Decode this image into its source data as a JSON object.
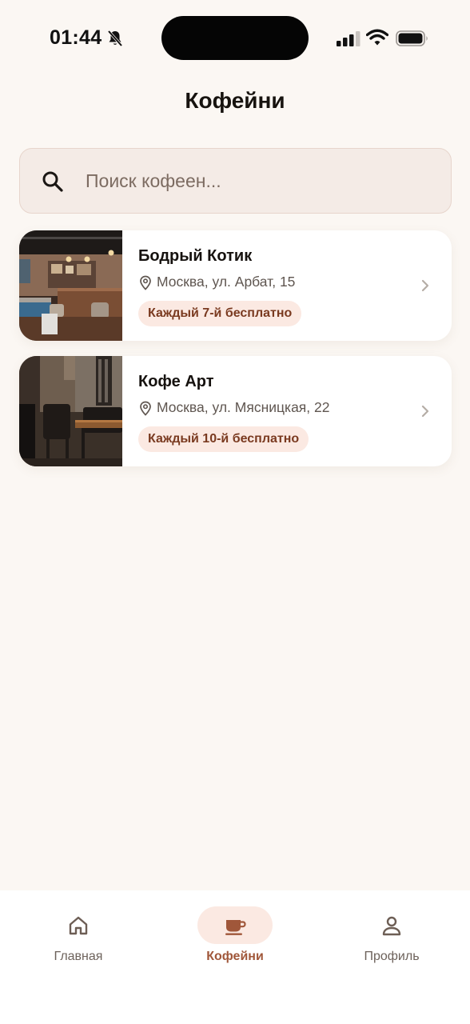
{
  "status_bar": {
    "time": "01:44"
  },
  "header": {
    "title": "Кофейни"
  },
  "search": {
    "placeholder": "Поиск кофеен..."
  },
  "cafes": [
    {
      "name": "Бодрый Котик",
      "address": "Москва, ул. Арбат, 15",
      "promo": "Каждый 7-й бесплатно"
    },
    {
      "name": "Кофе Арт",
      "address": "Москва, ул. Мясницкая, 22",
      "promo": "Каждый 10-й бесплатно"
    }
  ],
  "tab_bar": {
    "tabs": [
      {
        "label": "Главная",
        "icon": "home-icon",
        "active": false
      },
      {
        "label": "Кофейни",
        "icon": "coffee-cup-icon",
        "active": true
      },
      {
        "label": "Профиль",
        "icon": "person-icon",
        "active": false
      }
    ]
  },
  "colors": {
    "background": "#fbf7f3",
    "accent": "#a0573a",
    "badge_bg": "#fbe9e2",
    "search_bg": "#f4ebe6"
  }
}
